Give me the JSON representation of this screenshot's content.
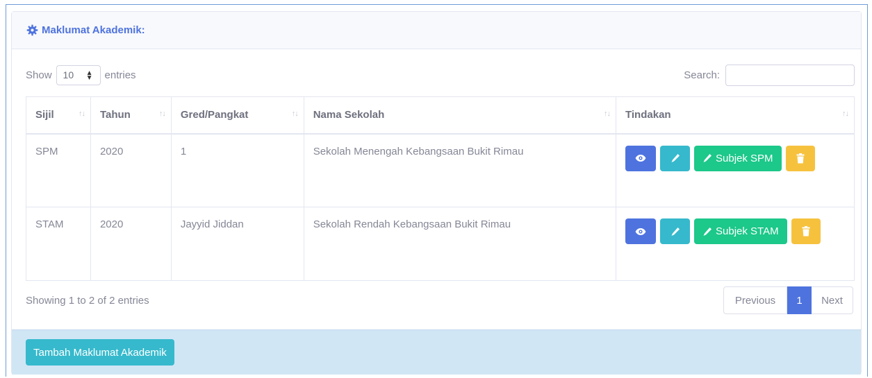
{
  "card": {
    "title": "Maklumat Akademik:"
  },
  "controls": {
    "show_label": "Show",
    "length_value": "10",
    "entries_label": "entries",
    "search_label": "Search:",
    "search_value": ""
  },
  "table": {
    "headers": [
      "Sijil",
      "Tahun",
      "Gred/Pangkat",
      "Nama Sekolah",
      "Tindakan"
    ],
    "rows": [
      {
        "sijil": "SPM",
        "tahun": "2020",
        "gred": "1",
        "sekolah": "Sekolah Menengah Kebangsaan Bukit Rimau",
        "subject_button": "Subjek SPM"
      },
      {
        "sijil": "STAM",
        "tahun": "2020",
        "gred": "Jayyid Jiddan",
        "sekolah": "Sekolah Rendah Kebangsaan Bukit Rimau",
        "subject_button": "Subjek STAM"
      }
    ]
  },
  "footer": {
    "info": "Showing 1 to 2 of 2 entries",
    "pagination": {
      "previous": "Previous",
      "current": "1",
      "next": "Next"
    },
    "add_button": "Tambah Maklumat Akademik"
  },
  "colors": {
    "primary": "#4e73df",
    "info": "#36b9cc",
    "success": "#1cc88a",
    "warning": "#f6c23e",
    "footer_bg": "#d0e6f5"
  },
  "icons": {
    "title": "cog-icon",
    "view": "eye-icon",
    "edit": "pencil-icon",
    "delete": "trash-icon"
  }
}
